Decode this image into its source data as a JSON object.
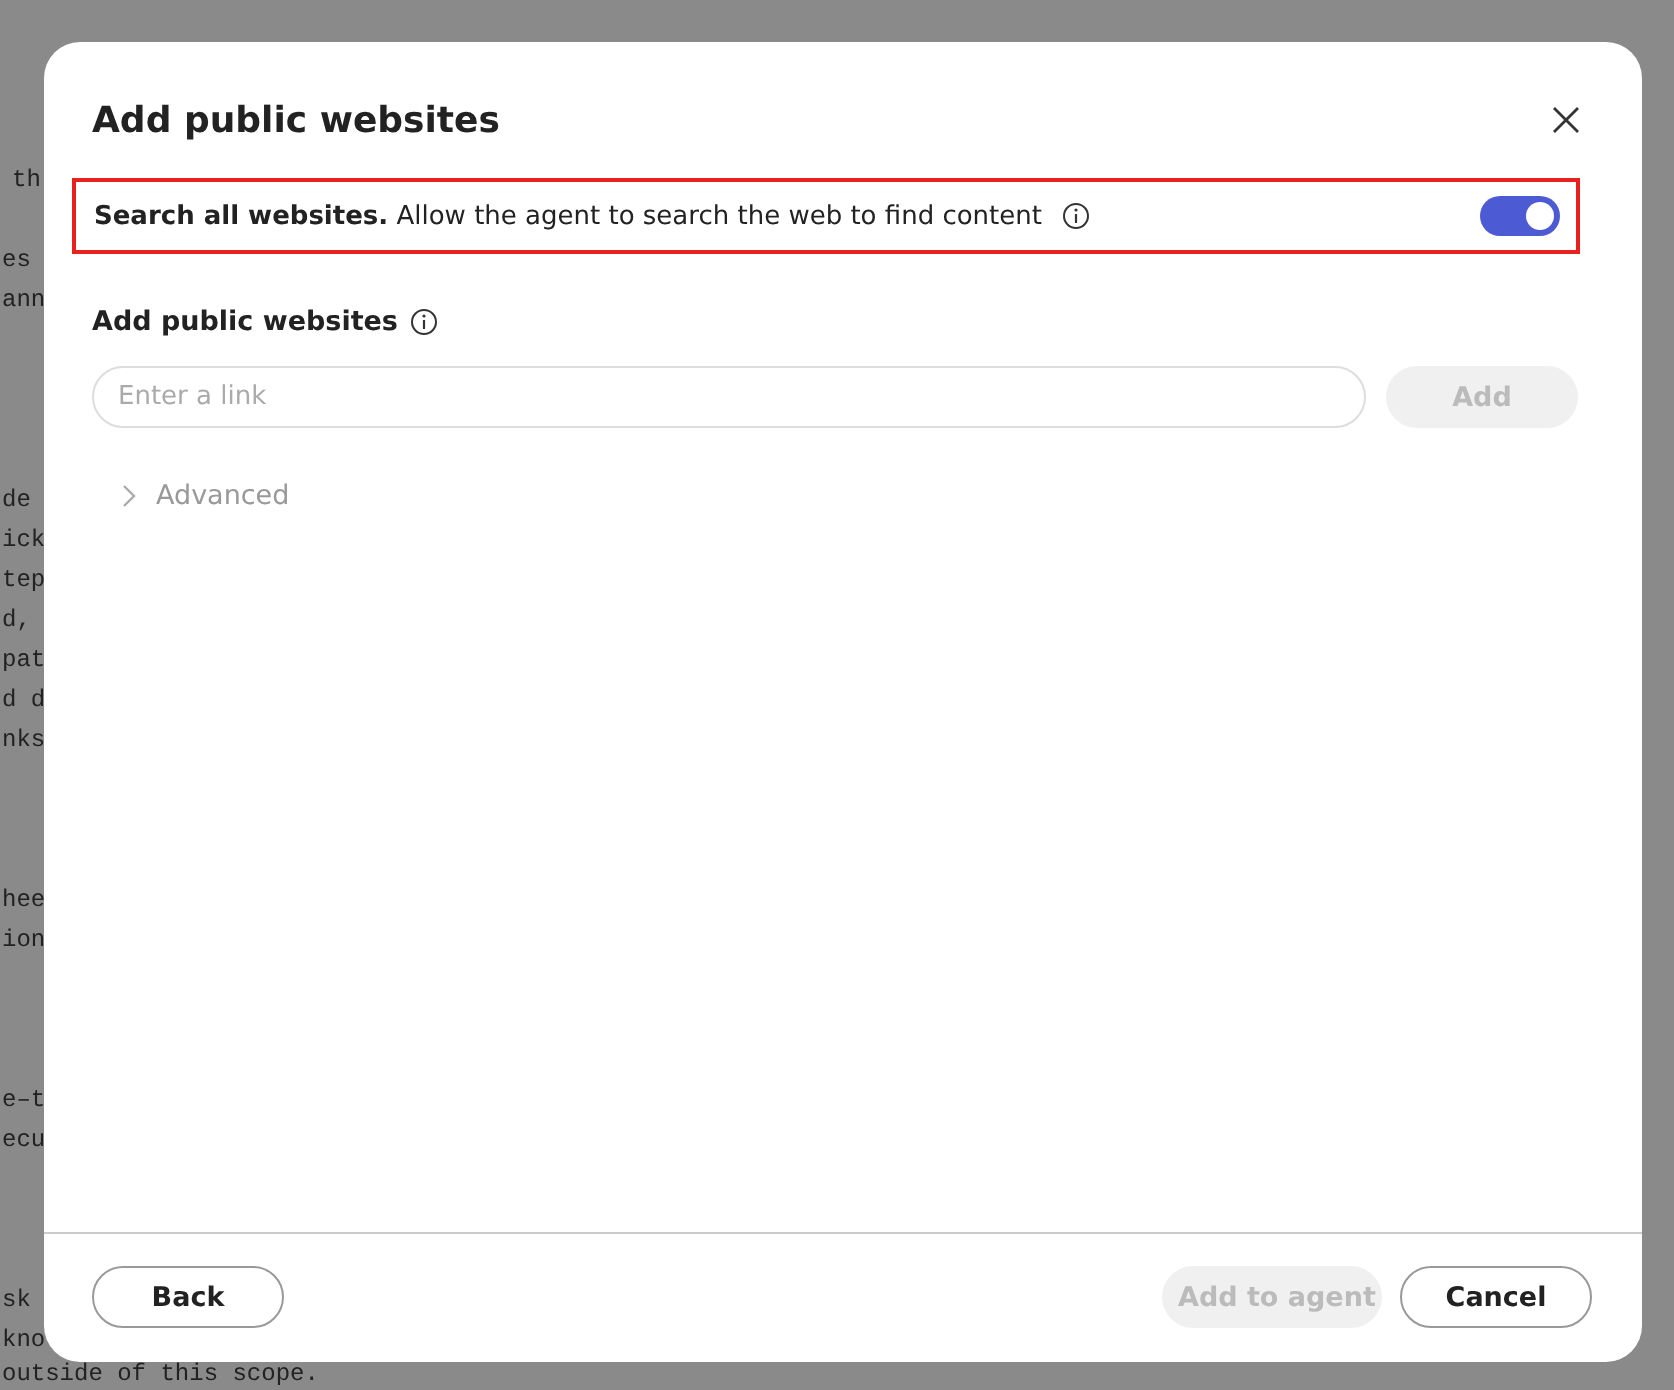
{
  "background_text": [
    [
      "th"
    ],
    [
      "es",
      "ann"
    ],
    [
      "de",
      "ick",
      "tep",
      "d,",
      "pat",
      "d d",
      "nks"
    ],
    [
      "hee",
      "ion"
    ],
    [
      "e–t",
      "ecu"
    ],
    [
      "sk",
      "kno",
      "outside of this scope."
    ]
  ],
  "dialog": {
    "title": "Add public websites",
    "search_all": {
      "text": "**Search all websites.** Allow the agent to search the web to find content",
      "on": true
    },
    "section_label": "Add public websites",
    "link_field": {
      "placeholder": "Enter a link"
    },
    "add_button": {
      "label": "Add",
      "disabled": true
    },
    "advanced": {
      "label": "Advanced",
      "expanded": false
    },
    "footer": {
      "back": {
        "label": "Back",
        "disabled": false
      },
      "add_to_agent": {
        "label": "Add to agent",
        "disabled": true
      },
      "cancel": {
        "label": "Cancel",
        "disabled": false
      }
    }
  }
}
